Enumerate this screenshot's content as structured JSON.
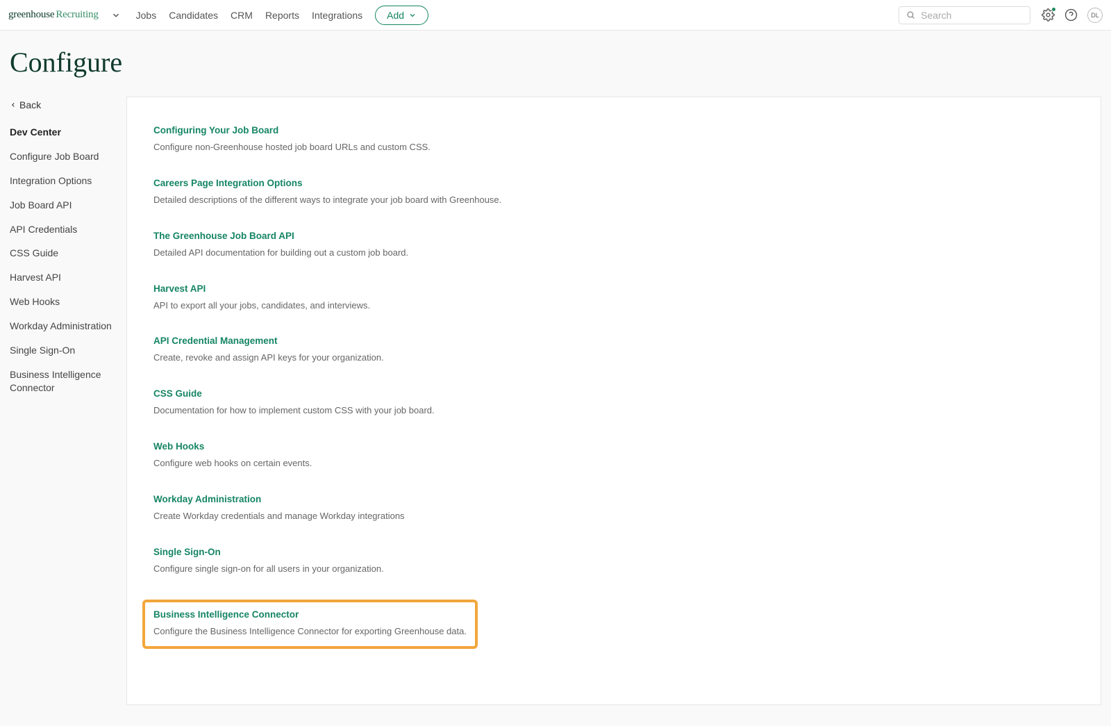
{
  "logo": {
    "word1": "greenhouse",
    "word2": "Recruiting"
  },
  "nav": {
    "links": [
      "Jobs",
      "Candidates",
      "CRM",
      "Reports",
      "Integrations"
    ],
    "add_label": "Add"
  },
  "search": {
    "placeholder": "Search"
  },
  "avatar_initials": "DL",
  "page_title": "Configure",
  "sidebar": {
    "back_label": "Back",
    "items": [
      {
        "label": "Dev Center",
        "active": true
      },
      {
        "label": "Configure Job Board"
      },
      {
        "label": "Integration Options"
      },
      {
        "label": "Job Board API"
      },
      {
        "label": "API Credentials"
      },
      {
        "label": "CSS Guide"
      },
      {
        "label": "Harvest API"
      },
      {
        "label": "Web Hooks"
      },
      {
        "label": "Workday Administration"
      },
      {
        "label": "Single Sign-On"
      },
      {
        "label": "Business Intelligence Connector"
      }
    ]
  },
  "entries": [
    {
      "title": "Configuring Your Job Board",
      "desc": "Configure non-Greenhouse hosted job board URLs and custom CSS."
    },
    {
      "title": "Careers Page Integration Options",
      "desc": "Detailed descriptions of the different ways to integrate your job board with Greenhouse."
    },
    {
      "title": "The Greenhouse Job Board API",
      "desc": "Detailed API documentation for building out a custom job board."
    },
    {
      "title": "Harvest API",
      "desc": "API to export all your jobs, candidates, and interviews."
    },
    {
      "title": "API Credential Management",
      "desc": "Create, revoke and assign API keys for your organization."
    },
    {
      "title": "CSS Guide",
      "desc": "Documentation for how to implement custom CSS with your job board."
    },
    {
      "title": "Web Hooks",
      "desc": "Configure web hooks on certain events."
    },
    {
      "title": "Workday Administration",
      "desc": "Create Workday credentials and manage Workday integrations"
    },
    {
      "title": "Single Sign-On",
      "desc": "Configure single sign-on for all users in your organization."
    },
    {
      "title": "Business Intelligence Connector",
      "desc": "Configure the Business Intelligence Connector for exporting Greenhouse data.",
      "highlighted": true
    }
  ]
}
